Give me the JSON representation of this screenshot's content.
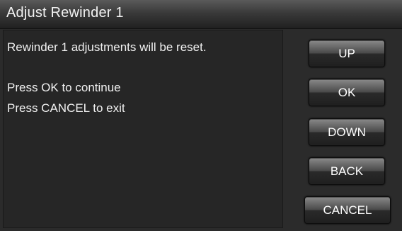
{
  "window": {
    "title": "Adjust Rewinder 1"
  },
  "message": {
    "line1": "Rewinder 1 adjustments will be reset.",
    "line2": "Press OK to continue",
    "line3": "Press CANCEL to exit"
  },
  "buttons": {
    "up": "UP",
    "ok": "OK",
    "down": "DOWN",
    "back": "BACK",
    "cancel": "CANCEL"
  },
  "colors": {
    "background": "#2b2b2b",
    "text": "#f0f0f0",
    "button_top": "#8a8a8a",
    "button_bottom": "#1f1f1f"
  }
}
